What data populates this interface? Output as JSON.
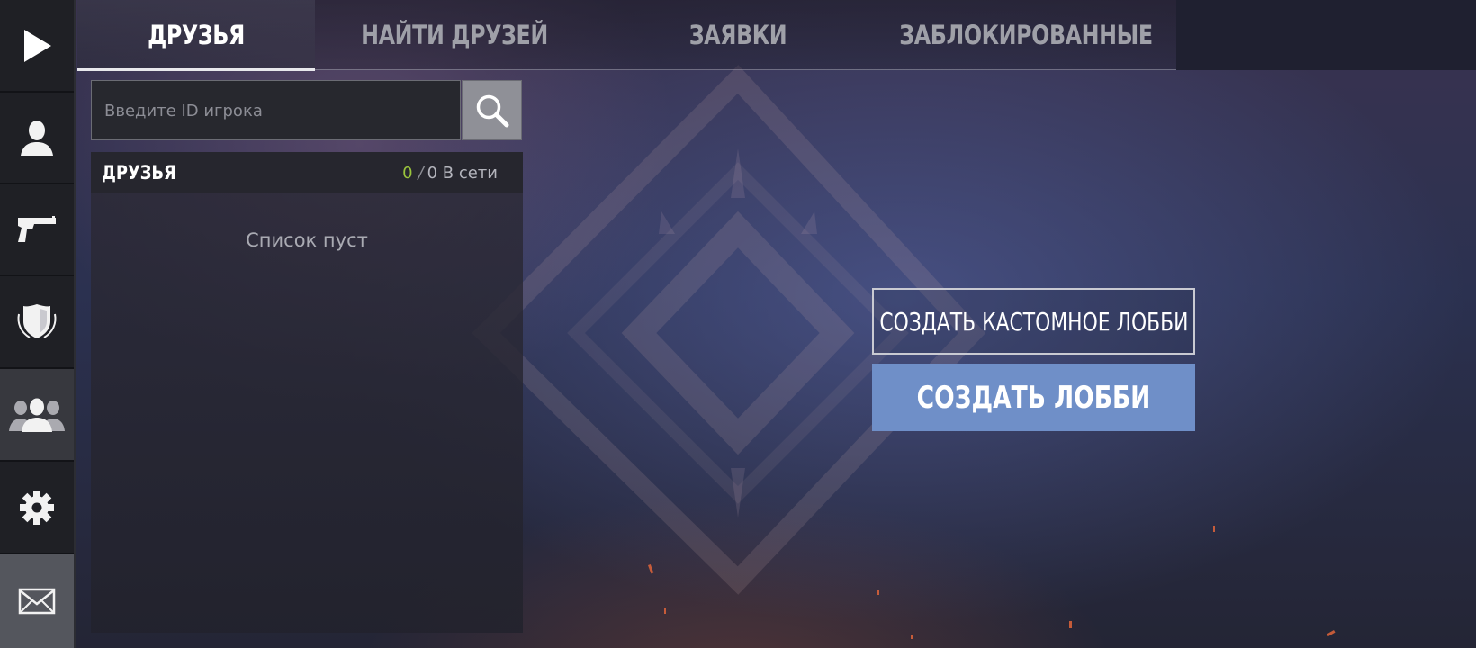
{
  "tabs": [
    {
      "label": "ДРУЗЬЯ",
      "active": true
    },
    {
      "label": "НАЙТИ ДРУЗЕЙ",
      "active": false
    },
    {
      "label": "ЗАЯВКИ",
      "active": false
    },
    {
      "label": "ЗАБЛОКИРОВАННЫЕ",
      "active": false
    }
  ],
  "sidebar": {
    "items": [
      {
        "icon": "play-icon"
      },
      {
        "icon": "profile-icon"
      },
      {
        "icon": "pistol-icon"
      },
      {
        "icon": "shield-laurel-icon"
      },
      {
        "icon": "friends-icon",
        "active": true
      },
      {
        "icon": "gear-icon"
      },
      {
        "icon": "mail-icon"
      }
    ]
  },
  "search": {
    "placeholder": "Введите ID игрока",
    "value": ""
  },
  "friends_panel": {
    "title": "ДРУЗЬЯ",
    "online_count": "0",
    "total_label": "0 В сети",
    "empty_text": "Список пуст"
  },
  "lobby": {
    "custom_button": "СОЗДАТЬ КАСТОМНОЕ ЛОББИ",
    "create_button": "СОЗДАТЬ ЛОББИ"
  },
  "colors": {
    "accent": "#6f8fc8",
    "online": "#9ac43c"
  }
}
